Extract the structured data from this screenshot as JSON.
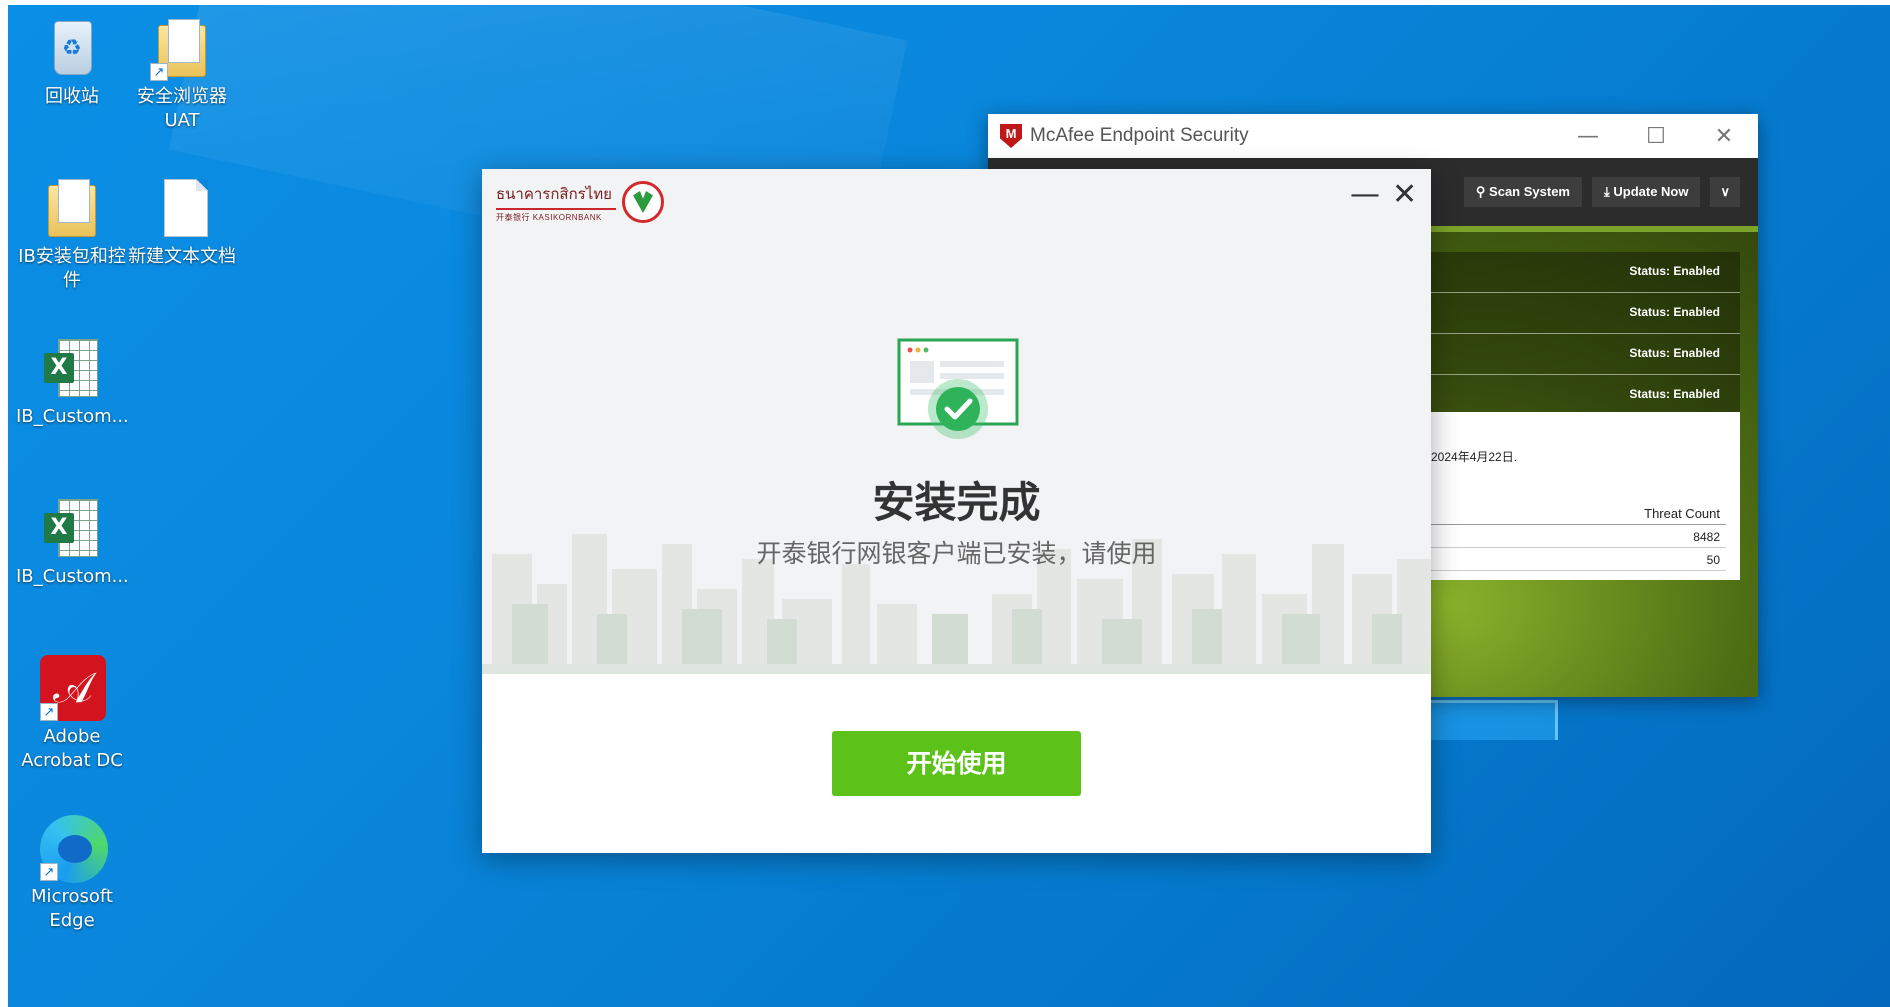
{
  "desktop": {
    "icons": [
      {
        "label": "回收站",
        "icon": "recycle-bin-icon"
      },
      {
        "label": "安全浏览器 UAT",
        "icon": "folder-shortcut-icon"
      },
      {
        "label": "IB安装包和控件",
        "icon": "folder-icon"
      },
      {
        "label": "新建文本文档",
        "icon": "text-document-icon"
      },
      {
        "label": "IB_Custom...",
        "icon": "excel-file-icon"
      },
      {
        "label": "IB_Custom...",
        "icon": "excel-file-icon"
      },
      {
        "label": "Adobe Acrobat DC",
        "icon": "adobe-acrobat-icon"
      },
      {
        "label": "Microsoft Edge",
        "icon": "microsoft-edge-icon"
      }
    ]
  },
  "mcafee": {
    "title": "McAfee Endpoint Security",
    "toolbar": {
      "scan_label": "Scan System",
      "update_label": "Update Now",
      "menu_glyph": "∨"
    },
    "statuses": [
      "Status: Enabled",
      "Status: Enabled",
      "Status: Enabled",
      "Status: Enabled"
    ],
    "info_date": "2024年4月22日.",
    "threat_header": "Threat Count",
    "threat_values": [
      "8482",
      "50"
    ],
    "accent_color": "#7aa32a"
  },
  "installer": {
    "brand_thai": "ธนาคารกสิกรไทย",
    "brand_en": "开泰银行 KASIKORNBANK",
    "title": "安装完成",
    "subtitle": "开泰银行网银客户端已安装，请使用",
    "start_button": "开始使用",
    "minimize_glyph": "—",
    "close_glyph": "✕",
    "button_color": "#5cc21a"
  }
}
